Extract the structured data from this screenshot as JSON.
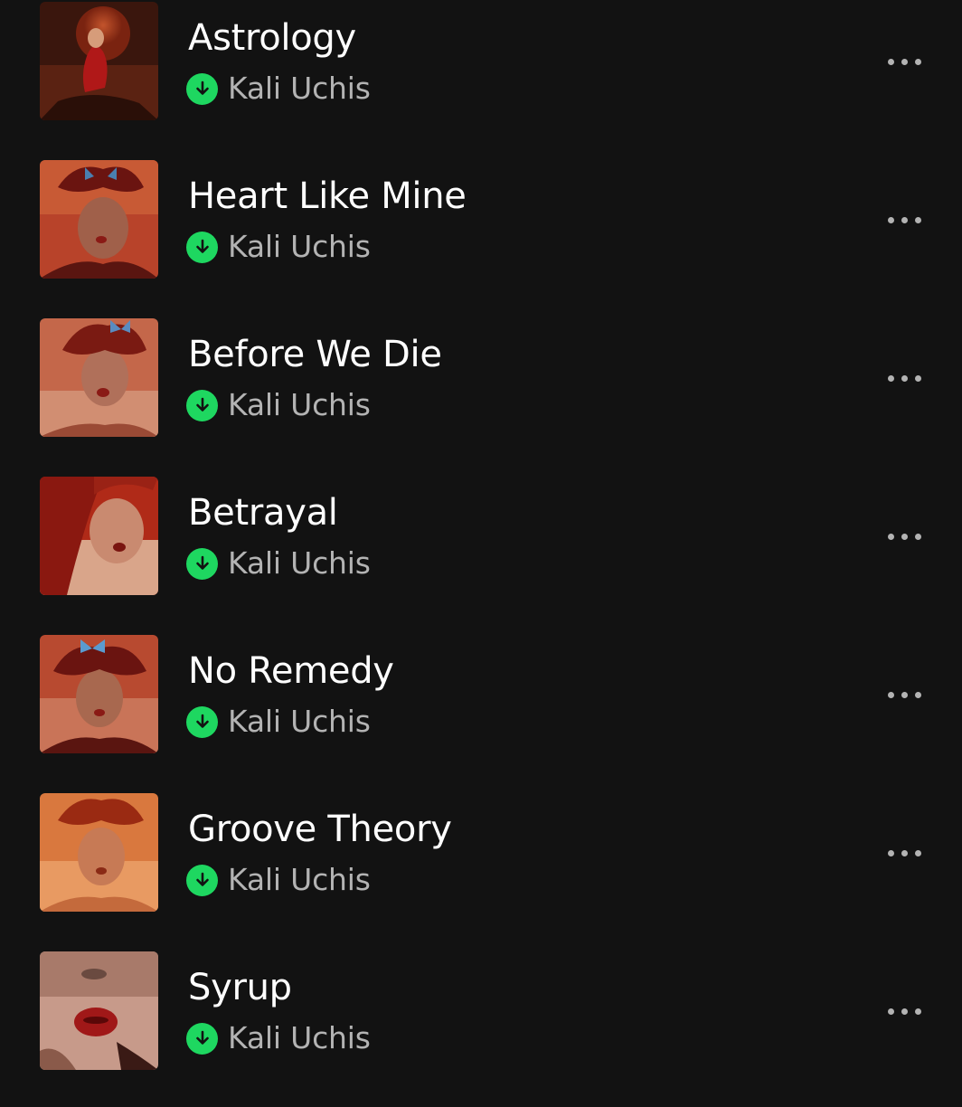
{
  "accent_color": "#1ed760",
  "background_color": "#121212",
  "tracks": [
    {
      "title": "Astrology",
      "artist": "Kali Uchis",
      "downloaded": true,
      "cover_theme": "moon"
    },
    {
      "title": "Heart Like Mine",
      "artist": "Kali Uchis",
      "downloaded": true,
      "cover_theme": "butterflies"
    },
    {
      "title": "Before We Die",
      "artist": "Kali Uchis",
      "downloaded": true,
      "cover_theme": "butterflies"
    },
    {
      "title": "Betrayal",
      "artist": "Kali Uchis",
      "downloaded": true,
      "cover_theme": "red-face"
    },
    {
      "title": "No Remedy",
      "artist": "Kali Uchis",
      "downloaded": true,
      "cover_theme": "butterflies"
    },
    {
      "title": "Groove Theory",
      "artist": "Kali Uchis",
      "downloaded": true,
      "cover_theme": "orange-face"
    },
    {
      "title": "Syrup",
      "artist": "Kali Uchis",
      "downloaded": true,
      "cover_theme": "lips"
    }
  ],
  "icons": {
    "download": "download-arrow-icon",
    "more": "more-options-icon"
  }
}
